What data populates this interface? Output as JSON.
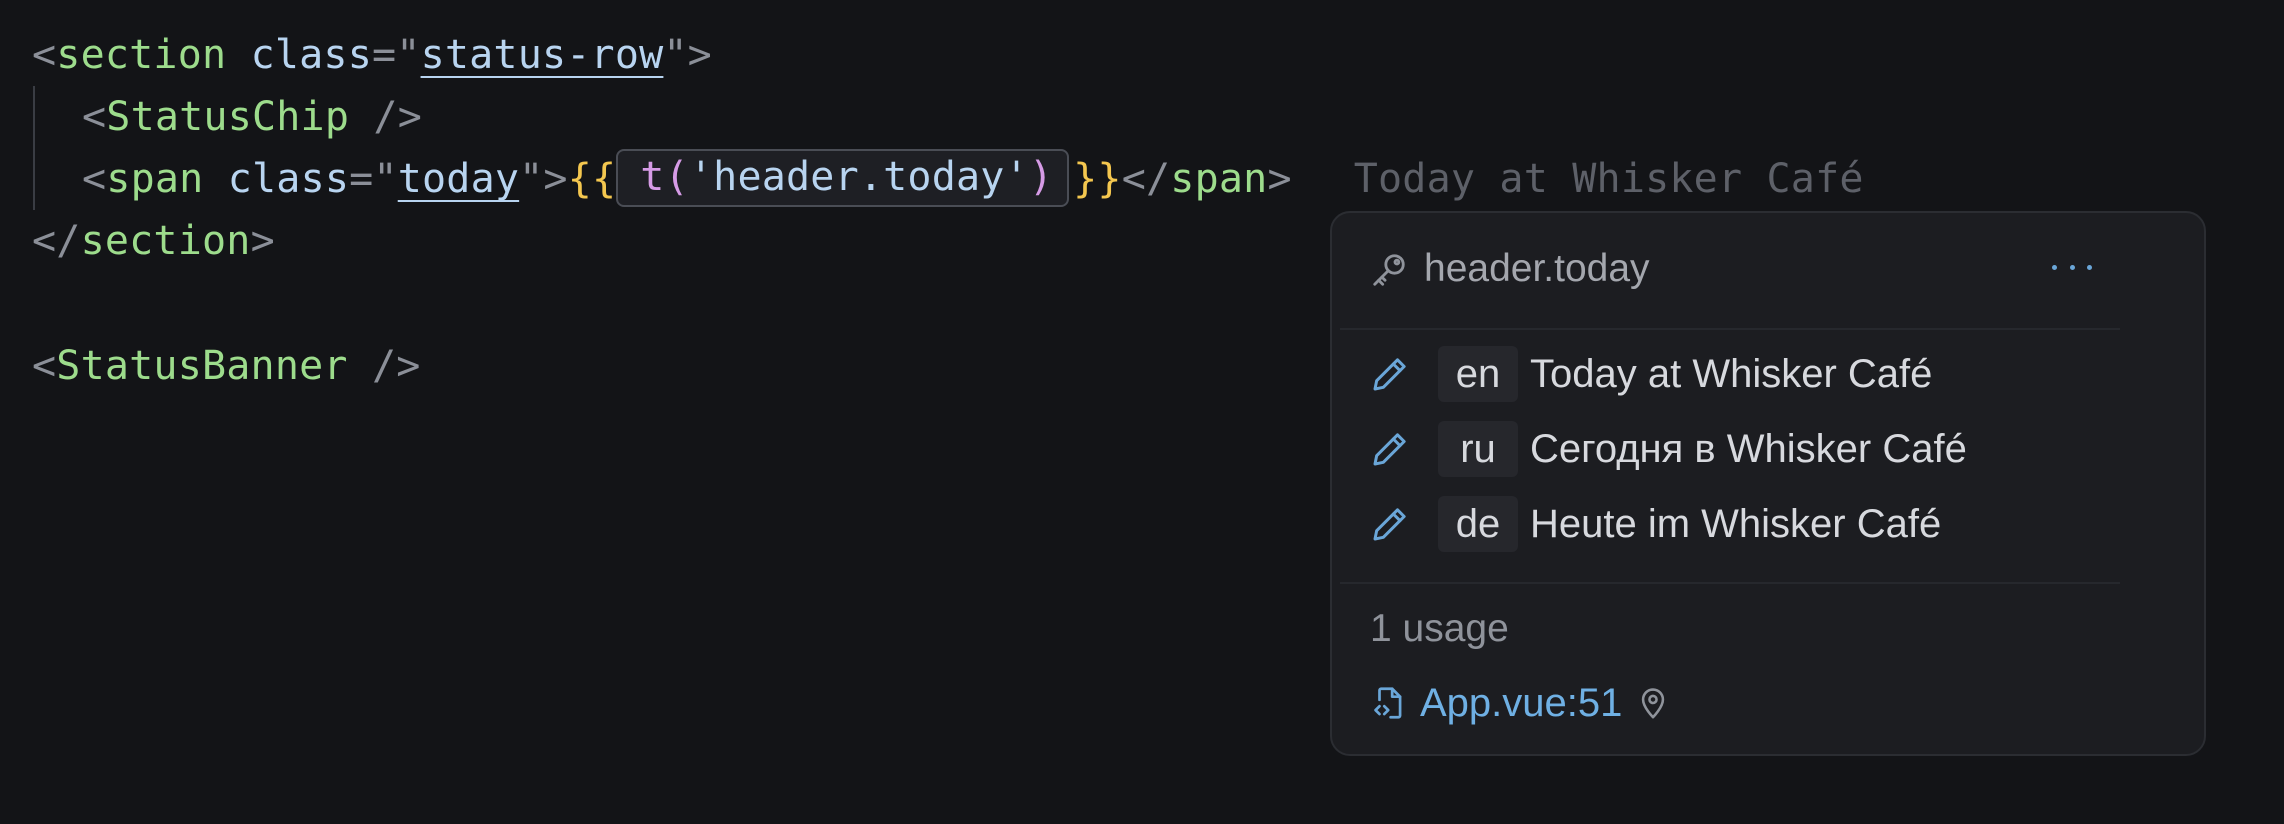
{
  "editor": {
    "line1": {
      "open": "<",
      "tag": "section",
      "attr": " class",
      "eq": "=\"",
      "value": "status-row",
      "close": "\">"
    },
    "line2": {
      "open": "<",
      "tag": "StatusChip",
      "close": " />"
    },
    "line3": {
      "open": "<",
      "tag": "span",
      "attr": " class",
      "eq": "=\"",
      "value": "today",
      "close_attr": "\">",
      "mustache_open": "{{",
      "fn": "t",
      "paren_open": "(",
      "arg": "'header.today'",
      "paren_close": ")",
      "mustache_close": "}}",
      "close_tag_open": "</",
      "close_tag": "span",
      "close_tag_end": ">",
      "inline_hint": "Today at Whisker Café"
    },
    "line4": {
      "open": "</",
      "tag": "section",
      "close": ">"
    },
    "line6": {
      "open": "<",
      "tag": "StatusBanner",
      "close": " />"
    }
  },
  "popup": {
    "key": "header.today",
    "more_label": "···",
    "translations": [
      {
        "lang": "en",
        "text": "Today at Whisker Café"
      },
      {
        "lang": "ru",
        "text": "Сегодня в Whisker Café"
      },
      {
        "lang": "de",
        "text": "Heute im Whisker Café"
      }
    ],
    "usage_count": "1 usage",
    "usage_file": "App.vue:51"
  },
  "colors": {
    "background": "#131417",
    "tag": "#9ddc8c",
    "attribute": "#b8d4f0",
    "mustache": "#f4c74f",
    "function": "#d69be6",
    "link": "#6fb0e4",
    "popup_bg": "#1c1d21"
  },
  "icons": {
    "key": "key-icon",
    "more": "more-horizontal-icon",
    "edit": "pencil-icon",
    "file": "file-code-icon",
    "location": "map-pin-icon"
  }
}
